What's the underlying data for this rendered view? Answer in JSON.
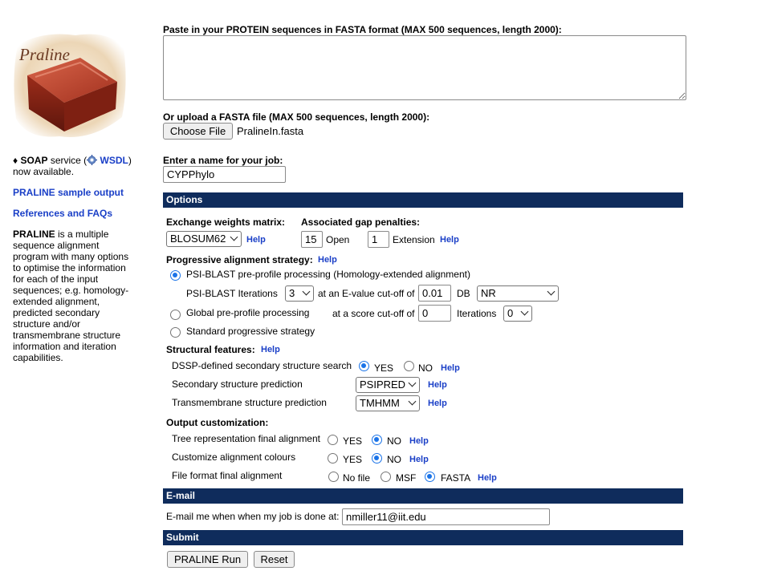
{
  "sidebar": {
    "logo_text": "Praline",
    "soap_bullet": "♦",
    "soap_bold": "SOAP",
    "soap_service": "service (",
    "wsdl_label": "WSDL",
    "soap_close": ")",
    "soap_line2": "now available.",
    "sample_output_link": "PRALINE sample output",
    "references_link": "References and FAQs",
    "desc_bold": "PRALINE",
    "desc_lines": [
      "is a multiple",
      "sequence alignment",
      "program with many options",
      "to optimise the information",
      "for each of the input",
      "sequences; e.g. homology-",
      "extended alignment,",
      "predicted secondary",
      "structure and/or",
      "transmembrane structure",
      "information and iteration",
      "capabilities."
    ]
  },
  "form": {
    "paste_label": "Paste in your PROTEIN sequences in FASTA format (MAX 500 sequences, length 2000):",
    "sequence_textarea_value": "",
    "upload_label": "Or upload a FASTA file (MAX 500 sequences, length 2000):",
    "choose_file_button": "Choose File",
    "chosen_file_name": "PralineIn.fasta",
    "job_name_label": "Enter a name for your job:",
    "job_name_value": "CYPPhylo"
  },
  "options": {
    "header": "Options",
    "exchange_matrix_label": "Exchange weights matrix:",
    "exchange_matrix_value": "BLOSUM62",
    "gap_penalties_label": "Associated gap penalties:",
    "gap_open_value": "15",
    "gap_open_label": "Open",
    "gap_extension_value": "1",
    "gap_extension_label": "Extension",
    "help": "Help",
    "progressive_label": "Progressive alignment strategy:",
    "psi_blast_option": "PSI-BLAST pre-profile processing (Homology-extended alignment)",
    "psi_iterations_label": "PSI-BLAST Iterations",
    "psi_iterations_value": "3",
    "evalue_label": "at an E-value cut-off of",
    "evalue_value": "0.01",
    "db_label": "DB",
    "db_value": "NR",
    "global_option": "Global pre-profile processing",
    "score_cutoff_label": "at a score cut-off of",
    "score_cutoff_value": "0",
    "iterations_label": "Iterations",
    "iterations_value": "0",
    "standard_option": "Standard progressive strategy",
    "structural_label": "Structural features:",
    "dssp_label": "DSSP-defined secondary structure search",
    "yes": "YES",
    "no": "NO",
    "secondary_label": "Secondary structure prediction",
    "secondary_value": "PSIPRED",
    "transmembrane_label": "Transmembrane structure prediction",
    "transmembrane_value": "TMHMM",
    "output_label": "Output customization:",
    "tree_label": "Tree representation final alignment",
    "colours_label": "Customize alignment colours",
    "file_format_label": "File format final alignment",
    "no_file": "No file",
    "msf": "MSF",
    "fasta": "FASTA"
  },
  "email": {
    "header": "E-mail",
    "label": "E-mail me when when my job is done at:",
    "value": "nmiller11@iit.edu"
  },
  "submit": {
    "header": "Submit",
    "run_button": "PRALINE Run",
    "reset_button": "Reset"
  },
  "colors": {
    "section_bar": "#0f2c5c",
    "link": "#1a3fc7",
    "radio_accent": "#1a73e8"
  }
}
